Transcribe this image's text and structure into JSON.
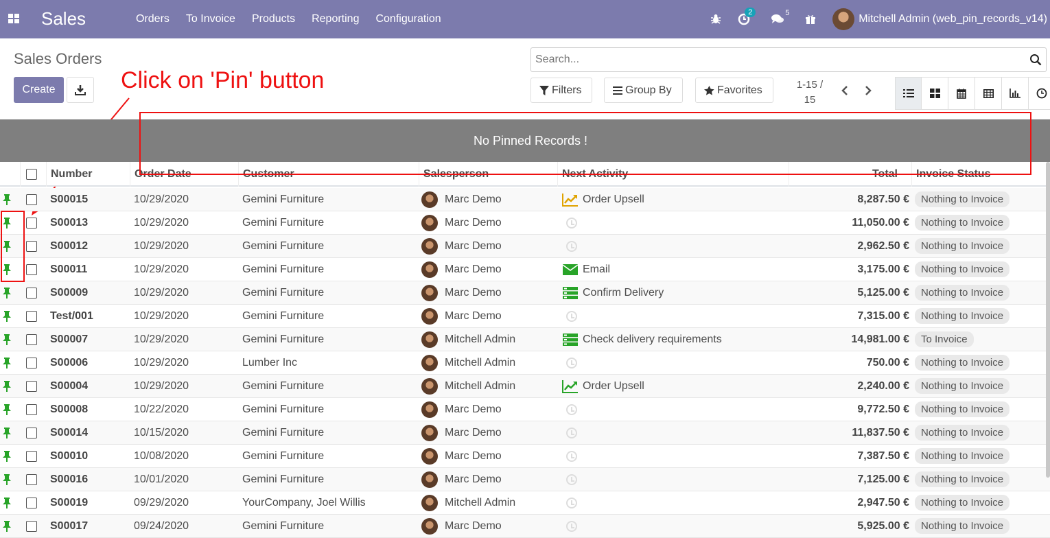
{
  "navbar": {
    "brand": "Sales",
    "menu": [
      "Orders",
      "To Invoice",
      "Products",
      "Reporting",
      "Configuration"
    ],
    "activity_count": "2",
    "message_count": "5",
    "user": "Mitchell Admin (web_pin_records_v14)"
  },
  "control_panel": {
    "title": "Sales Orders",
    "create_label": "Create",
    "search_placeholder": "Search...",
    "filters_label": "Filters",
    "group_by_label": "Group By",
    "favorites_label": "Favorites",
    "pager_value": "1-15 /",
    "pager_total": "15"
  },
  "annotation": {
    "text": "Click on 'Pin' button",
    "color": "#ee1111"
  },
  "pinned": {
    "message": "No Pinned Records !"
  },
  "table": {
    "columns": [
      "Number",
      "Order Date",
      "Customer",
      "Salesperson",
      "Next Activity",
      "Total",
      "Invoice Status"
    ],
    "rows": [
      {
        "number": "S00015",
        "date": "10/29/2020",
        "customer": "Gemini Furniture",
        "salesperson": "Marc Demo",
        "activity": "Order Upsell",
        "activity_icon": "upsell-chart-icon",
        "total": "8,287.50 €",
        "status": "Nothing to Invoice"
      },
      {
        "number": "S00013",
        "date": "10/29/2020",
        "customer": "Gemini Furniture",
        "salesperson": "Marc Demo",
        "activity": "",
        "activity_icon": "clock-icon",
        "total": "11,050.00 €",
        "status": "Nothing to Invoice"
      },
      {
        "number": "S00012",
        "date": "10/29/2020",
        "customer": "Gemini Furniture",
        "salesperson": "Marc Demo",
        "activity": "",
        "activity_icon": "clock-icon",
        "total": "2,962.50 €",
        "status": "Nothing to Invoice"
      },
      {
        "number": "S00011",
        "date": "10/29/2020",
        "customer": "Gemini Furniture",
        "salesperson": "Marc Demo",
        "activity": "Email",
        "activity_icon": "envelope-icon",
        "total": "3,175.00 €",
        "status": "Nothing to Invoice"
      },
      {
        "number": "S00009",
        "date": "10/29/2020",
        "customer": "Gemini Furniture",
        "salesperson": "Marc Demo",
        "activity": "Confirm Delivery",
        "activity_icon": "tasks-icon",
        "total": "5,125.00 €",
        "status": "Nothing to Invoice"
      },
      {
        "number": "Test/001",
        "date": "10/29/2020",
        "customer": "Gemini Furniture",
        "salesperson": "Marc Demo",
        "activity": "",
        "activity_icon": "clock-icon",
        "total": "7,315.00 €",
        "status": "Nothing to Invoice"
      },
      {
        "number": "S00007",
        "date": "10/29/2020",
        "customer": "Gemini Furniture",
        "salesperson": "Mitchell Admin",
        "activity": "Check delivery requirements",
        "activity_icon": "tasks-icon",
        "total": "14,981.00 €",
        "status": "To Invoice"
      },
      {
        "number": "S00006",
        "date": "10/29/2020",
        "customer": "Lumber Inc",
        "salesperson": "Mitchell Admin",
        "activity": "",
        "activity_icon": "clock-icon",
        "total": "750.00 €",
        "status": "Nothing to Invoice"
      },
      {
        "number": "S00004",
        "date": "10/29/2020",
        "customer": "Gemini Furniture",
        "salesperson": "Mitchell Admin",
        "activity": "Order Upsell",
        "activity_icon": "upsell-chart-icon-green",
        "total": "2,240.00 €",
        "status": "Nothing to Invoice"
      },
      {
        "number": "S00008",
        "date": "10/22/2020",
        "customer": "Gemini Furniture",
        "salesperson": "Marc Demo",
        "activity": "",
        "activity_icon": "clock-icon",
        "total": "9,772.50 €",
        "status": "Nothing to Invoice"
      },
      {
        "number": "S00014",
        "date": "10/15/2020",
        "customer": "Gemini Furniture",
        "salesperson": "Marc Demo",
        "activity": "",
        "activity_icon": "clock-icon",
        "total": "11,837.50 €",
        "status": "Nothing to Invoice"
      },
      {
        "number": "S00010",
        "date": "10/08/2020",
        "customer": "Gemini Furniture",
        "salesperson": "Marc Demo",
        "activity": "",
        "activity_icon": "clock-icon",
        "total": "7,387.50 €",
        "status": "Nothing to Invoice"
      },
      {
        "number": "S00016",
        "date": "10/01/2020",
        "customer": "Gemini Furniture",
        "salesperson": "Marc Demo",
        "activity": "",
        "activity_icon": "clock-icon",
        "total": "7,125.00 €",
        "status": "Nothing to Invoice"
      },
      {
        "number": "S00019",
        "date": "09/29/2020",
        "customer": "YourCompany, Joel Willis",
        "salesperson": "Mitchell Admin",
        "activity": "",
        "activity_icon": "clock-icon",
        "total": "2,947.50 €",
        "status": "Nothing to Invoice"
      },
      {
        "number": "S00017",
        "date": "09/24/2020",
        "customer": "Gemini Furniture",
        "salesperson": "Marc Demo",
        "activity": "",
        "activity_icon": "clock-icon",
        "total": "5,925.00 €",
        "status": "Nothing to Invoice"
      }
    ]
  },
  "colors": {
    "navbar": "#7c7bad",
    "pin": "#28a428",
    "pinned_bar": "#7f7f7f",
    "upsell": "#e0a300",
    "activity_green": "#28a428"
  }
}
